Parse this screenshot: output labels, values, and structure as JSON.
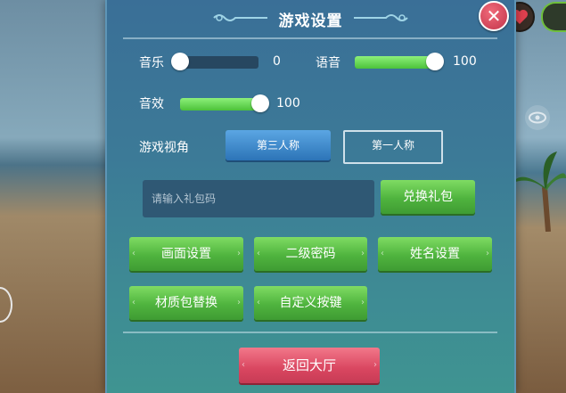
{
  "title": "游戏设置",
  "close_symbol": "✕",
  "settings": {
    "music": {
      "label": "音乐",
      "value": "0",
      "level": 0
    },
    "voice": {
      "label": "语音",
      "value": "100",
      "level": 100
    },
    "sfx": {
      "label": "音效",
      "value": "100",
      "level": 100
    }
  },
  "view": {
    "label": "游戏视角",
    "options": [
      "第三人称",
      "第一人称"
    ],
    "selected": "第三人称"
  },
  "gift": {
    "placeholder": "请输入礼包码",
    "button": "兑换礼包"
  },
  "buttons": {
    "graphics": "画面设置",
    "second_password": "二级密码",
    "name_settings": "姓名设置",
    "texture_pack": "材质包替换",
    "custom_keys": "自定义按键"
  },
  "return_button": "返回大厅",
  "side_icons": [
    "heart-icon",
    "eye-icon"
  ],
  "colors": {
    "panel": "#3a6f97",
    "green_button": "#4fb33e",
    "red_button": "#d94660",
    "slider_fill": "#4cc23a",
    "view_selected": "#2c74b7"
  }
}
